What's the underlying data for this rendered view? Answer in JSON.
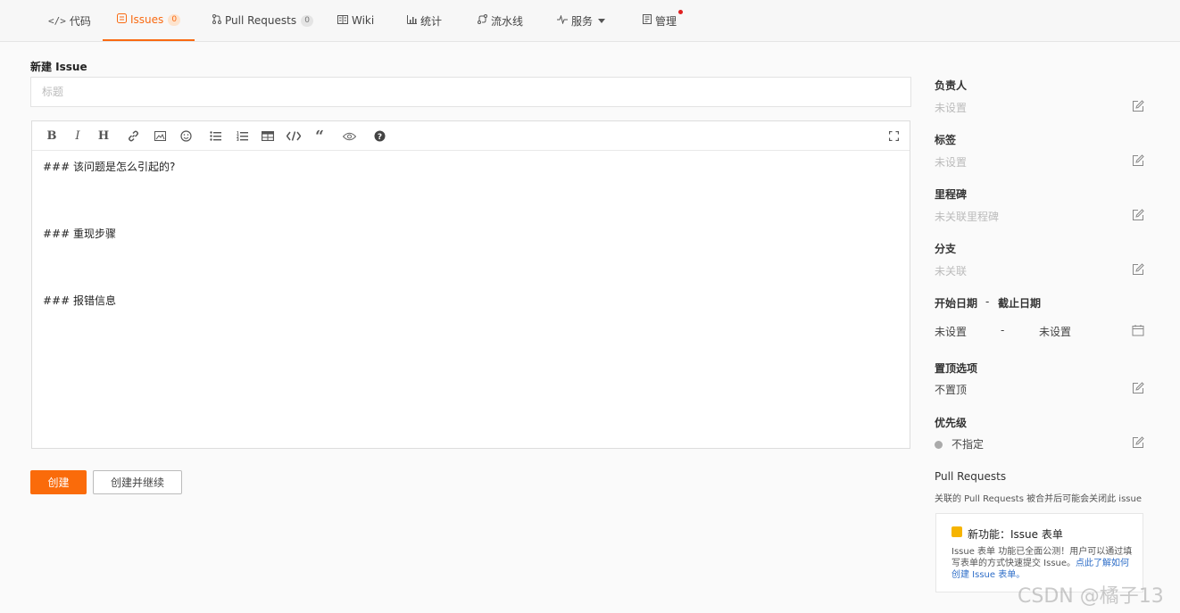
{
  "nav": {
    "tabs": [
      {
        "label": "代码",
        "icon": "code-icon"
      },
      {
        "label": "Issues",
        "icon": "issue-icon",
        "badge": "0"
      },
      {
        "label": "Pull Requests",
        "icon": "pull-request-icon",
        "badge": "0"
      },
      {
        "label": "Wiki",
        "icon": "wiki-icon"
      },
      {
        "label": "统计",
        "icon": "chart-icon"
      },
      {
        "label": "流水线",
        "icon": "pipeline-icon"
      },
      {
        "label": "服务",
        "icon": "pulse-icon"
      },
      {
        "label": "管理",
        "icon": "manage-icon"
      }
    ],
    "active_color": "#f96a12"
  },
  "form": {
    "heading": "新建 Issue",
    "title_placeholder": "标题",
    "title_value": "",
    "editor_lines": [
      "### 该问题是怎么引起的?",
      "### 重现步骤",
      "### 报错信息"
    ],
    "create_label": "创建",
    "create_continue_label": "创建并继续"
  },
  "sidebar": {
    "assignee": {
      "label": "负责人",
      "value": "未设置"
    },
    "tags": {
      "label": "标签",
      "value": "未设置"
    },
    "milestone": {
      "label": "里程碑",
      "value": "未关联里程碑"
    },
    "branch": {
      "label": "分支",
      "value": "未关联"
    },
    "dates": {
      "start_label": "开始日期",
      "separator": "-",
      "end_label": "截止日期",
      "start_value": "未设置",
      "end_value": "未设置"
    },
    "pin": {
      "label": "置顶选项",
      "value": "不置顶"
    },
    "priority": {
      "label": "优先级",
      "value": "不指定"
    },
    "pull_requests": {
      "label": "Pull Requests",
      "note": "关联的 Pull Requests 被合并后可能会关闭此 issue"
    },
    "feature": {
      "title": "新功能：Issue 表单",
      "desc": "Issue 表单 功能已全面公测！用户可以通过填写表单的方式快速提交 Issue。",
      "link": "点此了解如何创建 Issue 表单。"
    }
  },
  "watermark": "CSDN @橘子13",
  "colors": {
    "primary": "#fa6b0a",
    "link": "#2e6ec8"
  }
}
